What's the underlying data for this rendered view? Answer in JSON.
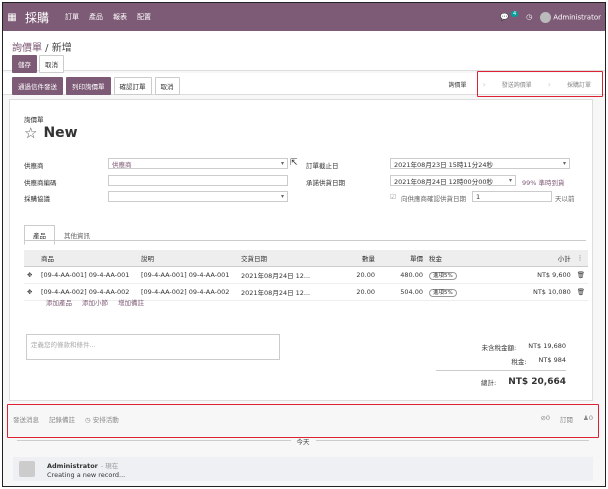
{
  "topbar": {
    "app_name": "採購",
    "menu": [
      "訂單",
      "產品",
      "報表",
      "配置"
    ],
    "message_count": "4",
    "user": "Administrator"
  },
  "breadcrumb": {
    "parent": "詢價單",
    "current": "新增"
  },
  "actions": {
    "save": "儲存",
    "discard": "取消"
  },
  "header_buttons": [
    "通過信件發送",
    "列印詢價單",
    "確認訂單",
    "取消"
  ],
  "statusbar": [
    "詢價單",
    "發送詢價單",
    "採購訂單"
  ],
  "form": {
    "doc_type": "詢價單",
    "name": "New",
    "vendor_label": "供應商",
    "vendor_value": "供應商",
    "vendor_ref_label": "供應商編碼",
    "agreement_label": "採購協議",
    "order_deadline_label": "訂單截止日",
    "order_deadline_value": "2021年08月23日 15時11分24秒",
    "receipt_date_label": "承諾供貨日期",
    "receipt_date_value": "2021年08月24日 12時00分00秒",
    "ontime_rate": "99% 準時到貨",
    "ask_confirm_label": "向供應商確認供貨日期",
    "ask_confirm_days": "1",
    "days_before": "天以前"
  },
  "tabs": [
    "產品",
    "其他資訊"
  ],
  "lines": {
    "headers": [
      "商品",
      "說明",
      "交貨日期",
      "數量",
      "單價",
      "稅金",
      "小計"
    ],
    "rows": [
      {
        "product": "[09-4-AA-001] 09-4-AA-001",
        "desc": "[09-4-AA-001] 09-4-AA-001",
        "date": "2021年08月24日 12...",
        "qty": "20.00",
        "price": "480.00",
        "tax": "進項5%",
        "subtotal": "NT$ 9,600"
      },
      {
        "product": "[09-4-AA-002] 09-4-AA-002",
        "desc": "[09-4-AA-002] 09-4-AA-002",
        "date": "2021年08月24日 12...",
        "qty": "20.00",
        "price": "504.00",
        "tax": "進項5%",
        "subtotal": "NT$ 10,080"
      }
    ],
    "add_links": [
      "添加產品",
      "添加小節",
      "增加備註"
    ]
  },
  "terms_placeholder": "定義您的條款和條件...",
  "totals": {
    "untaxed_label": "未含稅金額:",
    "untaxed": "NT$ 19,680",
    "tax_label": "稅金:",
    "tax": "NT$ 984",
    "total_label": "總計:",
    "total": "NT$ 20,664"
  },
  "chatter": {
    "send": "發送消息",
    "note": "記錄備註",
    "activity": "安排活動",
    "attachments": "0",
    "follow": "訂閱",
    "followers": "0",
    "today": "今天",
    "author": "Administrator",
    "ago": "- 現在",
    "message": "Creating a new record..."
  },
  "colors": {
    "brand": "#7d5a75",
    "highlight_box": "#dd2233"
  }
}
